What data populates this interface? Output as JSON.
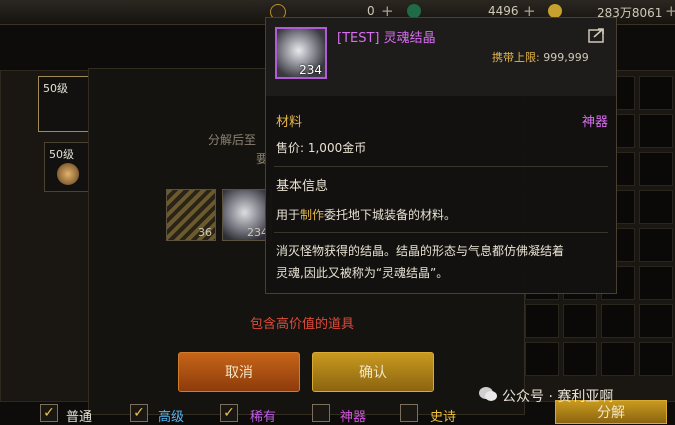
{
  "topbar": {
    "val1": "0",
    "val2": "4496",
    "val3": "283万8061"
  },
  "slots": [
    {
      "level": "50级"
    },
    {
      "level": "50级"
    }
  ],
  "dialog": {
    "line1": "分解后至",
    "line2": "要",
    "materials": [
      {
        "count": "36"
      },
      {
        "count": "234"
      }
    ],
    "warning": "包含高价值的道具",
    "cancel_label": "取消",
    "confirm_label": "确认"
  },
  "filters": [
    {
      "label": "普通",
      "checked": true,
      "color": "#e6e0d2"
    },
    {
      "label": "高级",
      "checked": true,
      "color": "#57b5f0"
    },
    {
      "label": "稀有",
      "checked": true,
      "color": "#c15de8"
    },
    {
      "label": "神器",
      "checked": false,
      "color": "#d451e0"
    },
    {
      "label": "史诗",
      "checked": false,
      "color": "#f0c23a"
    }
  ],
  "decompose_label": "分解",
  "watermark": "公众号 · 赛利亚啊",
  "tooltip": {
    "title": "[TEST] 灵魂结晶",
    "count": "234",
    "limit_label": "携带上限:",
    "limit_value": "999,999",
    "type": "材料",
    "rarity": "神器",
    "price": "售价: 1,000金币",
    "basic_info": "基本信息",
    "use_prefix": "用于",
    "use_highlight": "制作",
    "use_suffix": "委托地下城装备的材料。",
    "desc1": "消灭怪物获得的结晶。结晶的形态与气息都仿佛凝结着",
    "desc2": "灵魂,因此又被称为“灵魂结晶”。"
  },
  "colors": {
    "rarity_purple": "#d86ef2",
    "gold": "#e3b64c",
    "warning_red": "#e04b3a"
  }
}
